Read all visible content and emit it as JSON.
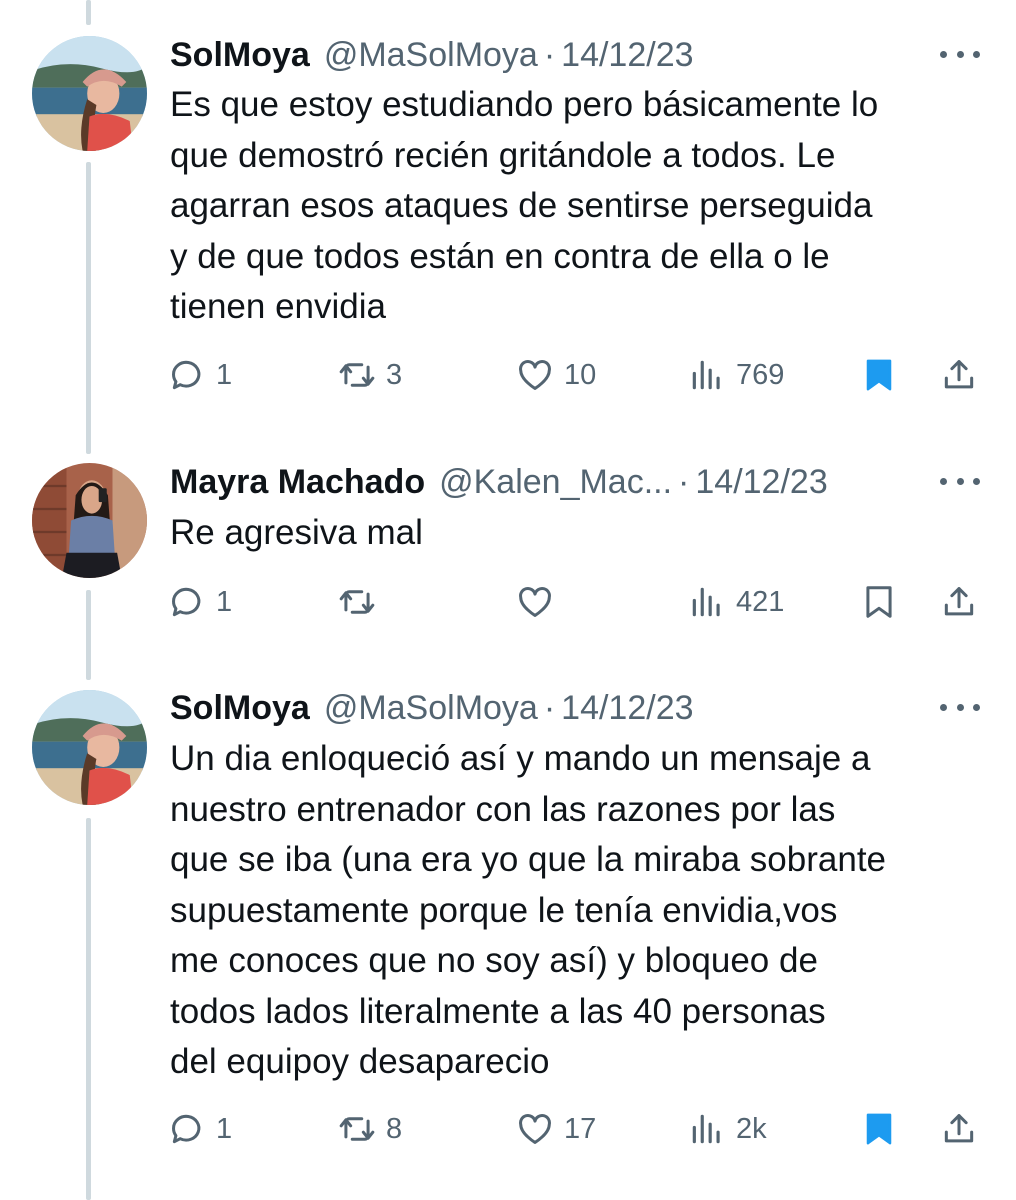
{
  "tweets": [
    {
      "name": "SolMoya",
      "handle": "@MaSolMoya",
      "separator": "·",
      "date": "14/12/23",
      "text_lines": [
        "Es que estoy estudiando pero básicamente lo",
        "que demostró recién gritándole a todos. Le",
        "agarran esos ataques de sentirse perseguida",
        "y de que todos están en contra de ella o le",
        "tienen envidia"
      ],
      "replies": "1",
      "retweets": "3",
      "likes": "10",
      "views": "769",
      "bookmarked": true
    },
    {
      "name": "Mayra Machado",
      "handle": "@Kalen_Mac...",
      "separator": "·",
      "date": "14/12/23",
      "text_lines": [
        "Re agresiva mal"
      ],
      "replies": "1",
      "retweets": "",
      "likes": "",
      "views": "421",
      "bookmarked": false
    },
    {
      "name": "SolMoya",
      "handle": "@MaSolMoya",
      "separator": "·",
      "date": "14/12/23",
      "text_lines": [
        "Un dia enloqueció así y mando un mensaje a",
        "nuestro entrenador con las razones por las",
        "que se iba (una era yo que la miraba sobrante",
        "supuestamente porque le tenía envidia,vos",
        "me conoces que no soy así) y bloqueo de",
        "todos lados literalmente a las 40 personas",
        "del equipoy desaparecio"
      ],
      "replies": "1",
      "retweets": "8",
      "likes": "17",
      "views": "2k",
      "bookmarked": true
    }
  ],
  "icons": {
    "reply": "reply-icon",
    "retweet": "retweet-icon",
    "like": "like-icon",
    "views": "views-icon",
    "bookmark": "bookmark-icon",
    "share": "share-icon",
    "more": "more-icon"
  },
  "colors": {
    "text": "#0f1419",
    "secondary": "#536471",
    "bookmark_active": "#1d9bf0",
    "thread_line": "#cfd9de"
  }
}
